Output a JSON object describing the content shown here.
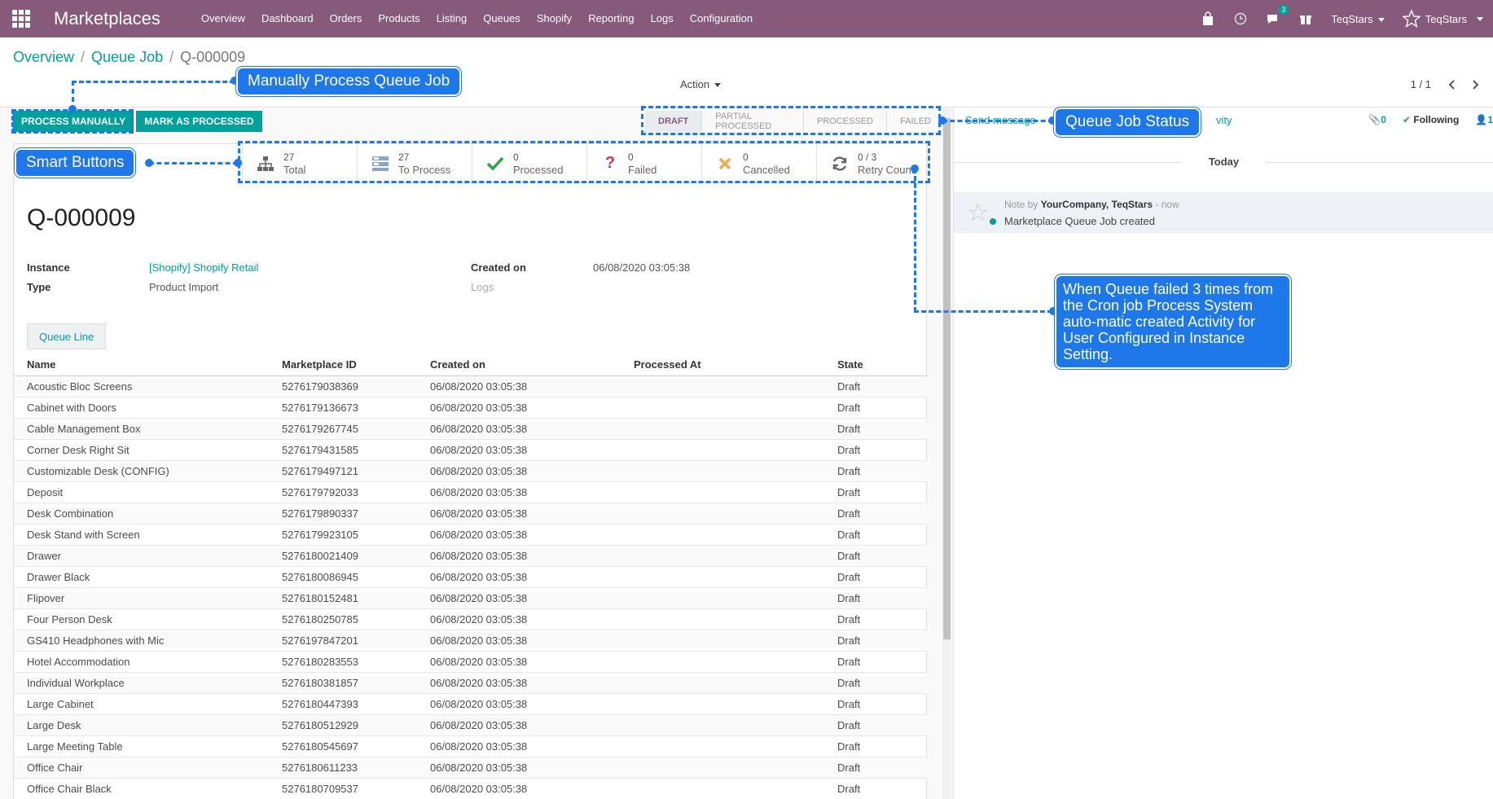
{
  "navbar": {
    "brand": "Marketplaces",
    "menu": [
      "Overview",
      "Dashboard",
      "Orders",
      "Products",
      "Listing",
      "Queues",
      "Shopify",
      "Reporting",
      "Logs",
      "Configuration"
    ],
    "messages_badge": "3",
    "company": "TeqStars",
    "user": "TeqStars",
    "color": "#875a7b"
  },
  "breadcrumb": {
    "items": [
      "Overview",
      "Queue Job"
    ],
    "current": "Q-000009",
    "separator": "/"
  },
  "control": {
    "action_label": "Action",
    "pager": "1 / 1"
  },
  "buttons": {
    "process_manually": "PROCESS MANUALLY",
    "mark_processed": "MARK AS PROCESSED"
  },
  "statusbar": {
    "steps": [
      "DRAFT",
      "PARTIAL PROCESSED",
      "PROCESSED",
      "FAILED"
    ],
    "active": "DRAFT"
  },
  "smart_buttons": [
    {
      "value": "27",
      "label": "Total",
      "icon": "sitemap-icon"
    },
    {
      "value": "27",
      "label": "To Process",
      "icon": "list-icon"
    },
    {
      "value": "0",
      "label": "Processed",
      "icon": "check-icon"
    },
    {
      "value": "0",
      "label": "Failed",
      "icon": "question-icon"
    },
    {
      "value": "0",
      "label": "Cancelled",
      "icon": "times-icon"
    },
    {
      "value": "0 / 3",
      "label": "Retry Count",
      "icon": "refresh-icon"
    }
  ],
  "record": {
    "title": "Q-000009",
    "instance_label": "Instance",
    "instance_value": "[Shopify] Shopify Retail",
    "type_label": "Type",
    "type_value": "Product Import",
    "created_label": "Created on",
    "created_value": "06/08/2020 03:05:38",
    "logs_label": "Logs"
  },
  "tab": {
    "label": "Queue Line"
  },
  "table": {
    "columns": [
      "Name",
      "Marketplace ID",
      "Created on",
      "Processed At",
      "State"
    ],
    "rows": [
      [
        "Acoustic Bloc Screens",
        "5276179038369",
        "06/08/2020 03:05:38",
        "",
        "Draft"
      ],
      [
        "Cabinet with Doors",
        "5276179136673",
        "06/08/2020 03:05:38",
        "",
        "Draft"
      ],
      [
        "Cable Management Box",
        "5276179267745",
        "06/08/2020 03:05:38",
        "",
        "Draft"
      ],
      [
        "Corner Desk Right Sit",
        "5276179431585",
        "06/08/2020 03:05:38",
        "",
        "Draft"
      ],
      [
        "Customizable Desk (CONFIG)",
        "5276179497121",
        "06/08/2020 03:05:38",
        "",
        "Draft"
      ],
      [
        "Deposit",
        "5276179792033",
        "06/08/2020 03:05:38",
        "",
        "Draft"
      ],
      [
        "Desk Combination",
        "5276179890337",
        "06/08/2020 03:05:38",
        "",
        "Draft"
      ],
      [
        "Desk Stand with Screen",
        "5276179923105",
        "06/08/2020 03:05:38",
        "",
        "Draft"
      ],
      [
        "Drawer",
        "5276180021409",
        "06/08/2020 03:05:38",
        "",
        "Draft"
      ],
      [
        "Drawer Black",
        "5276180086945",
        "06/08/2020 03:05:38",
        "",
        "Draft"
      ],
      [
        "Flipover",
        "5276180152481",
        "06/08/2020 03:05:38",
        "",
        "Draft"
      ],
      [
        "Four Person Desk",
        "5276180250785",
        "06/08/2020 03:05:38",
        "",
        "Draft"
      ],
      [
        "GS410 Headphones with Mic",
        "5276197847201",
        "06/08/2020 03:05:38",
        "",
        "Draft"
      ],
      [
        "Hotel Accommodation",
        "5276180283553",
        "06/08/2020 03:05:38",
        "",
        "Draft"
      ],
      [
        "Individual Workplace",
        "5276180381857",
        "06/08/2020 03:05:38",
        "",
        "Draft"
      ],
      [
        "Large Cabinet",
        "5276180447393",
        "06/08/2020 03:05:38",
        "",
        "Draft"
      ],
      [
        "Large Desk",
        "5276180512929",
        "06/08/2020 03:05:38",
        "",
        "Draft"
      ],
      [
        "Large Meeting Table",
        "5276180545697",
        "06/08/2020 03:05:38",
        "",
        "Draft"
      ],
      [
        "Office Chair",
        "5276180611233",
        "06/08/2020 03:05:38",
        "",
        "Draft"
      ],
      [
        "Office Chair Black",
        "5276180709537",
        "06/08/2020 03:05:38",
        "",
        "Draft"
      ]
    ]
  },
  "chatter": {
    "send_message": "Send message",
    "activity_fragment": "vity",
    "attachments": "0",
    "following": "Following",
    "followers": "1",
    "today": "Today",
    "message_prefix": "Note by",
    "message_author": "YourCompany, TeqStars",
    "message_time": "- now",
    "message_body": "Marketplace Queue Job created"
  },
  "annotations": {
    "manual": "Manually Process Queue Job",
    "status": "Queue Job Status",
    "smart": "Smart Buttons",
    "retry": "When Queue failed 3 times from the Cron job Process System auto-matic created Activity for User Configured in Instance Setting.",
    "color": "#1e78ea"
  }
}
